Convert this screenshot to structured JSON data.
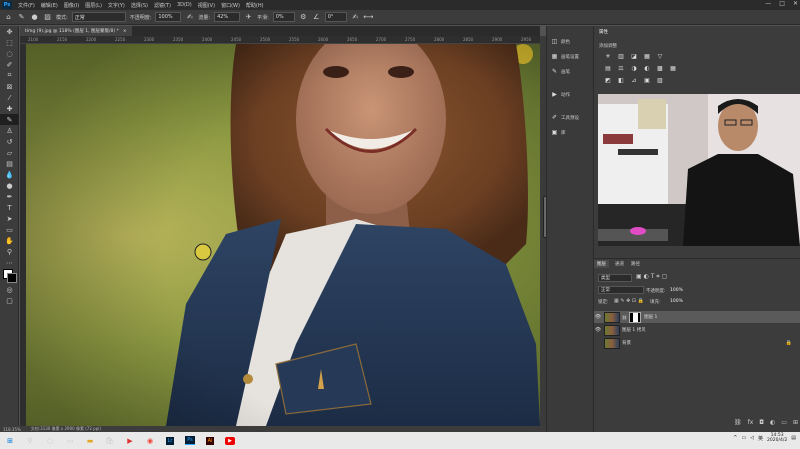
{
  "menu": {
    "app_icon": "Ps",
    "items": [
      "文件(F)",
      "编辑(E)",
      "图像(I)",
      "图层(L)",
      "文字(Y)",
      "选择(S)",
      "滤镜(T)",
      "3D(D)",
      "视图(V)",
      "窗口(W)",
      "帮助(H)"
    ],
    "window_controls": [
      "—",
      "□",
      "✕"
    ]
  },
  "options_bar": {
    "mode_label": "模式:",
    "mode_value": "正常",
    "opacity_label": "不透明度:",
    "opacity_value": "100%",
    "flow_label": "流量:",
    "flow_value": "42%",
    "smooth_label": "平滑:",
    "smooth_value": "0%",
    "angle_value": "0°"
  },
  "document": {
    "tab_title": "timg (9).jpg @ 118% (图层 1, 图层蒙版/8) *",
    "close_symbol": "×",
    "ruler_ticks": [
      "2100",
      "2150",
      "2200",
      "2250",
      "2300",
      "2350",
      "2400",
      "2450",
      "2500",
      "2550",
      "2600",
      "2650",
      "2700",
      "2750",
      "2800",
      "2850",
      "2900",
      "2950"
    ]
  },
  "status_bar": {
    "zoom": "118.35%",
    "doc_info": "文档:3130 像素 x 2900 像素 (72 ppi)"
  },
  "panel_column": {
    "items": [
      {
        "icon": "history-icon",
        "label": "颜色"
      },
      {
        "icon": "swatches-icon",
        "label": "画笔设置"
      },
      {
        "icon": "brush-icon",
        "label": "画笔"
      },
      {
        "icon": "actions-icon",
        "label": "动作"
      },
      {
        "icon": "tool-presets-icon",
        "label": "工具预设"
      },
      {
        "icon": "text-icon",
        "label": "库"
      }
    ]
  },
  "right_panel": {
    "tabs": [
      "属性",
      "调整"
    ],
    "adjustments_label": "添加调整",
    "adjustment_rows": [
      [
        "☀",
        "▥",
        "◪",
        "▦",
        "▽"
      ],
      [
        "▤",
        "⚖",
        "◑",
        "◐",
        "▩",
        "▦"
      ],
      [
        "◩",
        "◧",
        "⊿",
        "▣",
        "▨"
      ]
    ]
  },
  "layers_panel": {
    "tabs": [
      "图层",
      "通道",
      "路径"
    ],
    "filter_label": "类型",
    "blend_mode": "正常",
    "opacity_label": "不透明度:",
    "opacity_value": "100%",
    "lock_label": "锁定:",
    "fill_label": "填充:",
    "fill_value": "100%",
    "layers": [
      {
        "name": "图层 1",
        "selected": true,
        "has_mask": true
      },
      {
        "name": "图层 1 拷贝",
        "selected": false,
        "has_mask": false
      },
      {
        "name": "背景",
        "selected": false,
        "has_mask": false,
        "locked": true
      }
    ]
  },
  "taskbar": {
    "apps": [
      "start-icon",
      "search-icon",
      "task-view-icon",
      "edge-icon",
      "file-explorer-icon",
      "store-icon",
      "media-player-icon",
      "chrome-icon",
      "lightroom-icon",
      "photoshop-icon",
      "illustrator-icon",
      "youtube-icon"
    ],
    "tray_time": "14:53",
    "tray_date": "2020/4/2",
    "tray_lang": "英"
  }
}
